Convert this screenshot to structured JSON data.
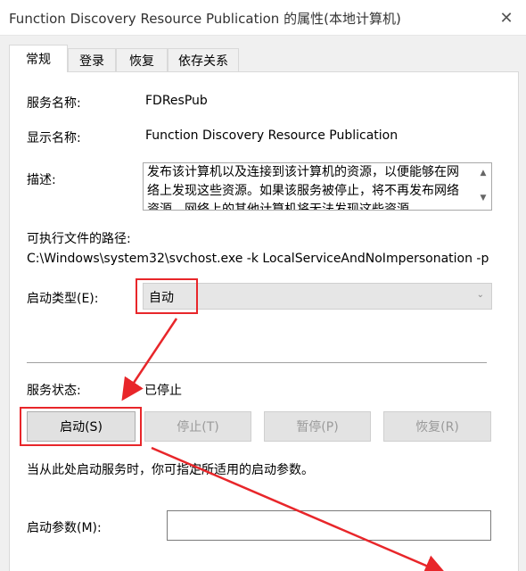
{
  "window": {
    "title": "Function Discovery Resource Publication 的属性(本地计算机)",
    "close_glyph": "✕"
  },
  "tabs": [
    {
      "label": "常规",
      "active": true
    },
    {
      "label": "登录",
      "active": false
    },
    {
      "label": "恢复",
      "active": false
    },
    {
      "label": "依存关系",
      "active": false
    }
  ],
  "general": {
    "service_name_label": "服务名称:",
    "service_name_value": "FDResPub",
    "display_name_label": "显示名称:",
    "display_name_value": "Function Discovery Resource Publication",
    "description_label": "描述:",
    "description_value": "发布该计算机以及连接到该计算机的资源，以便能够在网络上发现这些资源。如果该服务被停止，将不再发布网络资源，网络上的其他计算机将无法发现这些资源。",
    "exe_path_label": "可执行文件的路径:",
    "exe_path_value": "C:\\Windows\\system32\\svchost.exe -k LocalServiceAndNoImpersonation -p",
    "startup_type_label": "启动类型(E):",
    "startup_type_value": "自动",
    "status_label": "服务状态:",
    "status_value": "已停止",
    "buttons": {
      "start": "启动(S)",
      "stop": "停止(T)",
      "pause": "暂停(P)",
      "resume": "恢复(R)"
    },
    "hint_text": "当从此处启动服务时，你可指定所适用的启动参数。",
    "start_params_label": "启动参数(M):",
    "start_params_value": ""
  },
  "annotation": {
    "color": "#e8262a"
  }
}
